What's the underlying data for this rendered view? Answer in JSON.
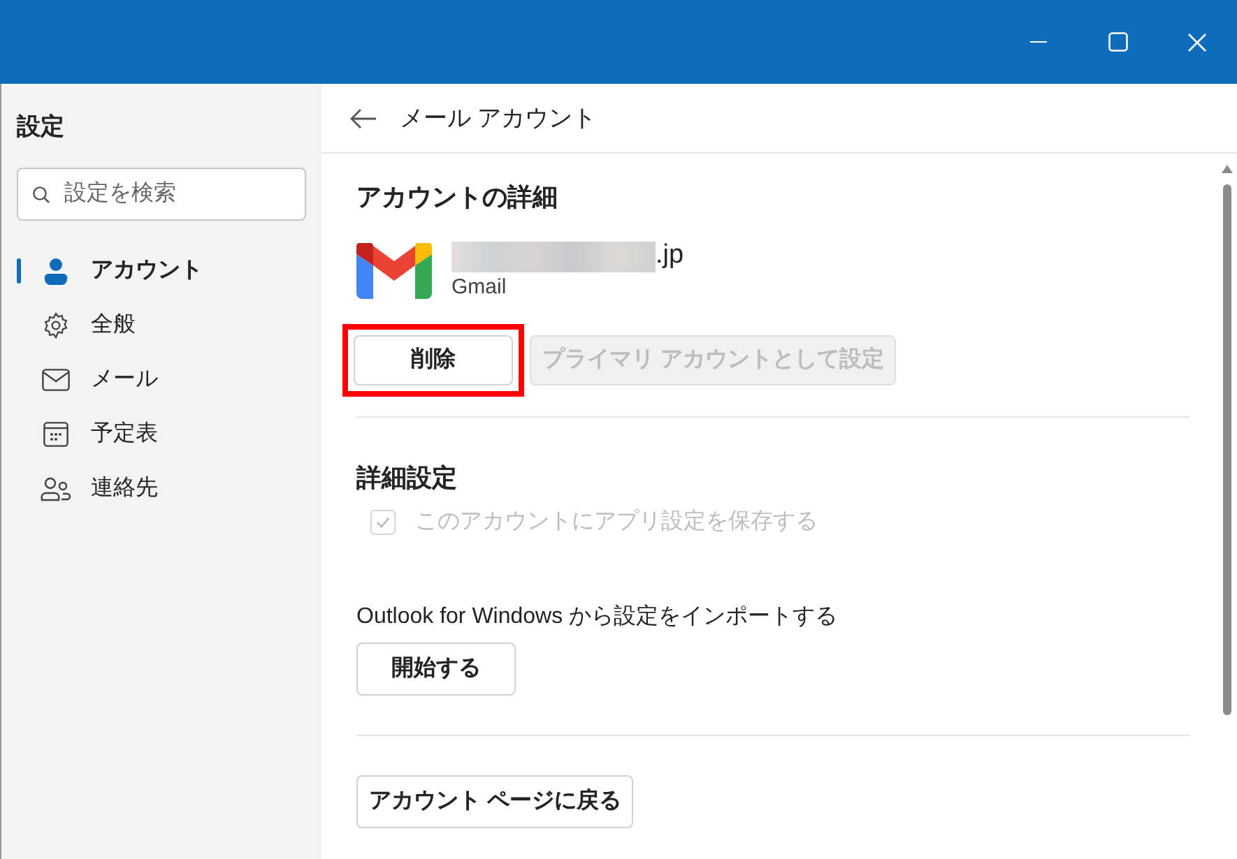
{
  "sidebar": {
    "title": "設定",
    "search": {
      "placeholder": "設定を検索"
    },
    "items": [
      {
        "label": "アカウント",
        "selected": true
      },
      {
        "label": "全般",
        "selected": false
      },
      {
        "label": "メール",
        "selected": false
      },
      {
        "label": "予定表",
        "selected": false
      },
      {
        "label": "連絡先",
        "selected": false
      }
    ]
  },
  "header": {
    "title": "メール アカウント"
  },
  "account_details": {
    "heading": "アカウントの詳細",
    "email_suffix": ".jp",
    "provider": "Gmail",
    "buttons": [
      {
        "label": "削除",
        "disabled": false,
        "highlighted": true
      },
      {
        "label": "プライマリ アカウントとして設定",
        "disabled": true,
        "highlighted": false
      }
    ]
  },
  "advanced": {
    "heading": "詳細設定",
    "checkbox": {
      "label": "このアカウントにアプリ設定を保存する",
      "checked": true,
      "disabled": true
    },
    "import_label": "Outlook for Windows から設定をインポートする",
    "import_button": "開始する"
  },
  "back_button": "アカウント ページに戻る"
}
